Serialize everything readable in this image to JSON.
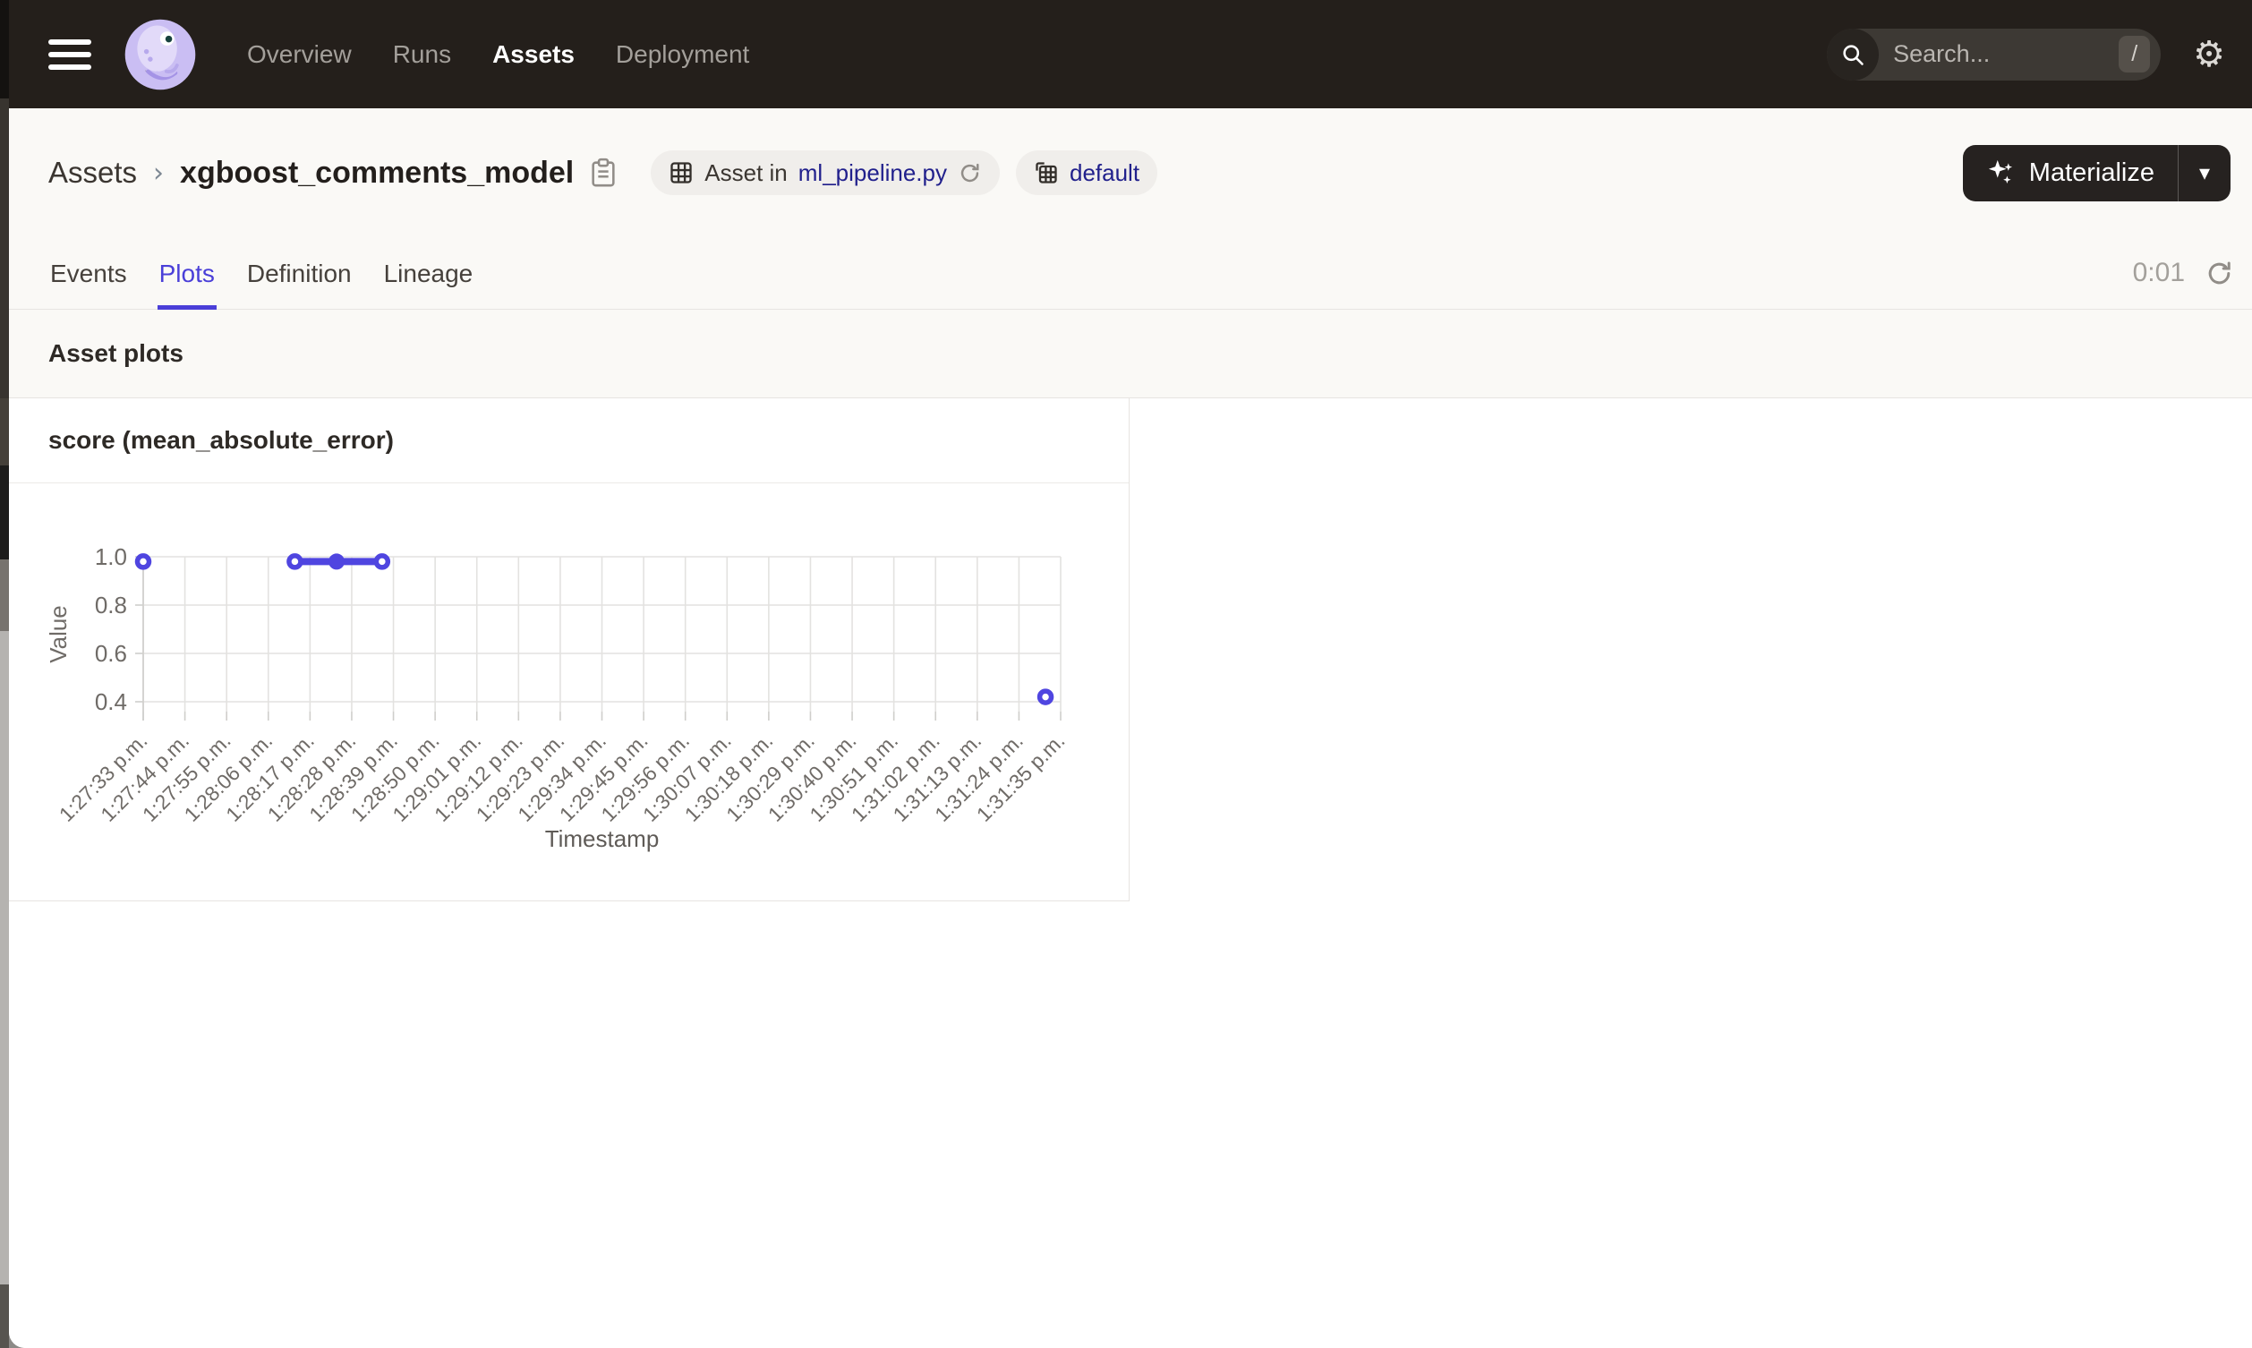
{
  "topbar": {
    "nav": [
      {
        "label": "Overview",
        "active": false
      },
      {
        "label": "Runs",
        "active": false
      },
      {
        "label": "Assets",
        "active": true
      },
      {
        "label": "Deployment",
        "active": false
      }
    ],
    "search": {
      "placeholder": "Search...",
      "shortcut": "/"
    },
    "settings_icon": "gear"
  },
  "header": {
    "breadcrumb": {
      "parent": "Assets",
      "separator": "›",
      "current": "xgboost_comments_model"
    },
    "badges": [
      {
        "icon": "asset-grid",
        "prefix": "Asset in ",
        "link": "ml_pipeline.py",
        "has_reload_icon": true
      },
      {
        "icon": "code-location",
        "prefix": "",
        "link": "default",
        "has_reload_icon": false
      }
    ],
    "materialize": {
      "label": "Materialize",
      "caret": "▾"
    }
  },
  "tabs": {
    "items": [
      {
        "label": "Events",
        "active": false
      },
      {
        "label": "Plots",
        "active": true
      },
      {
        "label": "Definition",
        "active": false
      },
      {
        "label": "Lineage",
        "active": false
      }
    ],
    "refresh_timer": "0:01"
  },
  "section": {
    "title": "Asset plots"
  },
  "chart_card": {
    "title": "score (mean_absolute_error)"
  },
  "chart_data": {
    "type": "line",
    "title": "score (mean_absolute_error)",
    "xlabel": "Timestamp",
    "ylabel": "Value",
    "grid": true,
    "legend": "none",
    "y_ticks": [
      1.0,
      0.8,
      0.6,
      0.4
    ],
    "ylim_bottom": 0.36,
    "x_tick_interval_seconds": 11,
    "x_tick_labels": [
      "1:27:33 p.m.",
      "1:27:44 p.m.",
      "1:27:55 p.m.",
      "1:28:06 p.m.",
      "1:28:17 p.m.",
      "1:28:28 p.m.",
      "1:28:39 p.m.",
      "1:28:50 p.m.",
      "1:29:01 p.m.",
      "1:29:12 p.m.",
      "1:29:23 p.m.",
      "1:29:34 p.m.",
      "1:29:45 p.m.",
      "1:29:56 p.m.",
      "1:30:07 p.m.",
      "1:30:18 p.m.",
      "1:30:29 p.m.",
      "1:30:40 p.m.",
      "1:30:51 p.m.",
      "1:31:02 p.m.",
      "1:31:13 p.m.",
      "1:31:24 p.m.",
      "1:31:35 p.m."
    ],
    "line_color": "#4f45e0",
    "series": [
      {
        "name": "score (mean_absolute_error)",
        "points": [
          {
            "t_seconds": 0,
            "approx_time": "1:27:33 p.m.",
            "value": 0.98,
            "marker": "open"
          },
          {
            "t_seconds": 40,
            "approx_time": "1:28:13 p.m.",
            "value": 0.98,
            "marker": "open"
          },
          {
            "t_seconds": 51,
            "approx_time": "1:28:24 p.m.",
            "value": 0.98,
            "marker": "filled"
          },
          {
            "t_seconds": 63,
            "approx_time": "1:28:36 p.m.",
            "value": 0.98,
            "marker": "open"
          },
          {
            "t_seconds": 238,
            "approx_time": "1:31:31 p.m.",
            "value": 0.42,
            "marker": "open"
          }
        ],
        "connected_segments": [
          [
            1,
            2,
            3
          ]
        ]
      }
    ]
  }
}
